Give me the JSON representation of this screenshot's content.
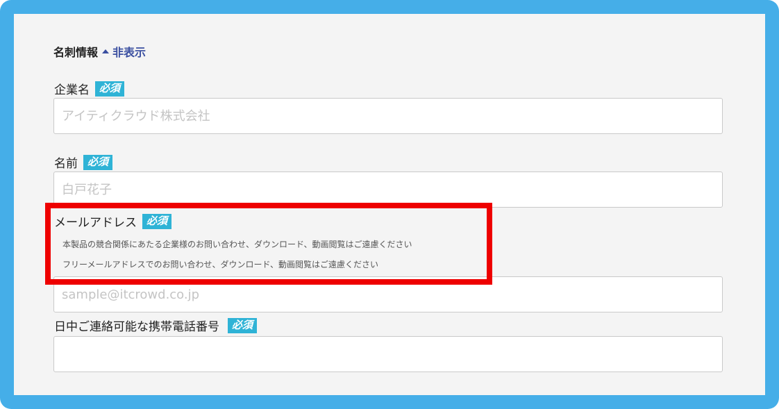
{
  "section": {
    "title": "名刺情報",
    "toggle_label": "非表示"
  },
  "required_badge": "必須",
  "fields": {
    "company": {
      "label": "企業名",
      "placeholder": "アイティクラウド株式会社"
    },
    "name": {
      "label": "名前",
      "placeholder": "白戸花子"
    },
    "email": {
      "label": "メールアドレス",
      "notes": [
        "本製品の競合関係にあたる企業様のお問い合わせ、ダウンロード、動画閲覧はご遠慮ください",
        "フリーメールアドレスでのお問い合わせ、ダウンロード、動画閲覧はご遠慮ください"
      ],
      "placeholder": "sample@itcrowd.co.jp"
    },
    "phone": {
      "label": "日中ご連絡可能な携帯電話番号",
      "placeholder": ""
    }
  },
  "colors": {
    "frame": "#45aee8",
    "badge": "#2fb3d6",
    "link": "#3a4fa0",
    "highlight": "#ee0000"
  }
}
